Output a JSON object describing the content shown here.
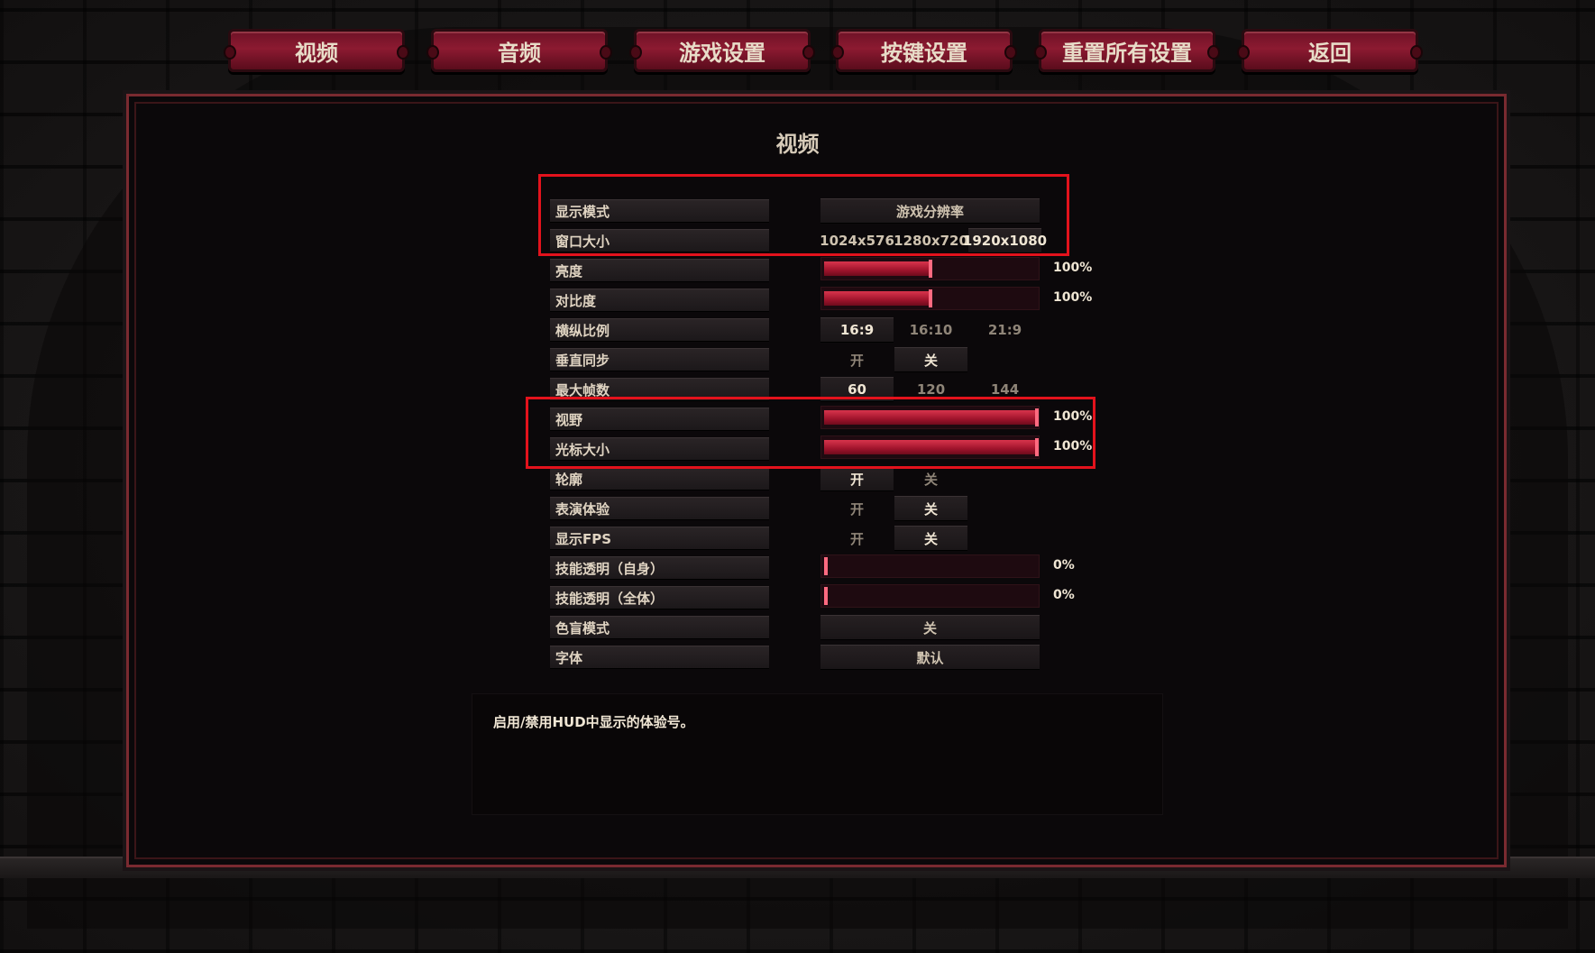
{
  "tabs": [
    {
      "label": "视频"
    },
    {
      "label": "音频"
    },
    {
      "label": "游戏设置"
    },
    {
      "label": "按键设置"
    },
    {
      "label": "重置所有设置"
    },
    {
      "label": "返回"
    }
  ],
  "panel": {
    "title": "视频"
  },
  "settings": {
    "display_mode": {
      "label": "显示模式",
      "value": "游戏分辨率"
    },
    "window_size": {
      "label": "窗口大小",
      "options": [
        "1024x576",
        "1280x720",
        "1920x1080"
      ],
      "selected": "1920x1080"
    },
    "brightness": {
      "label": "亮度",
      "value": "100%",
      "level": 0.5
    },
    "contrast": {
      "label": "对比度",
      "value": "100%",
      "level": 0.5
    },
    "aspect_ratio": {
      "label": "横纵比例",
      "options": [
        "16:9",
        "16:10",
        "21:9"
      ],
      "selected": "16:9"
    },
    "vsync": {
      "label": "垂直同步",
      "options": [
        "开",
        "关"
      ],
      "selected": "关"
    },
    "max_fps": {
      "label": "最大帧数",
      "options": [
        "60",
        "120",
        "144"
      ],
      "selected": "60"
    },
    "fov": {
      "label": "视野",
      "value": "100%",
      "level": 1.0
    },
    "cursor_size": {
      "label": "光标大小",
      "value": "100%",
      "level": 1.0
    },
    "outline": {
      "label": "轮廓",
      "options": [
        "开",
        "关"
      ],
      "selected": "开"
    },
    "performance_experience": {
      "label": "表演体验",
      "options": [
        "开",
        "关"
      ],
      "selected": "关"
    },
    "show_fps": {
      "label": "显示FPS",
      "options": [
        "开",
        "关"
      ],
      "selected": "关"
    },
    "skill_transparency_self": {
      "label": "技能透明（自身）",
      "value": "0%",
      "level": 0.0
    },
    "skill_transparency_all": {
      "label": "技能透明（全体）",
      "value": "0%",
      "level": 0.0
    },
    "colorblind_mode": {
      "label": "色盲模式",
      "value": "关"
    },
    "font": {
      "label": "字体",
      "value": "默认"
    }
  },
  "description": "启用/禁用HUD中显示的体验号。",
  "colors": {
    "accent": "#8c1a31",
    "highlight_box": "#e3121c",
    "slider_fill": "#c8243c"
  }
}
